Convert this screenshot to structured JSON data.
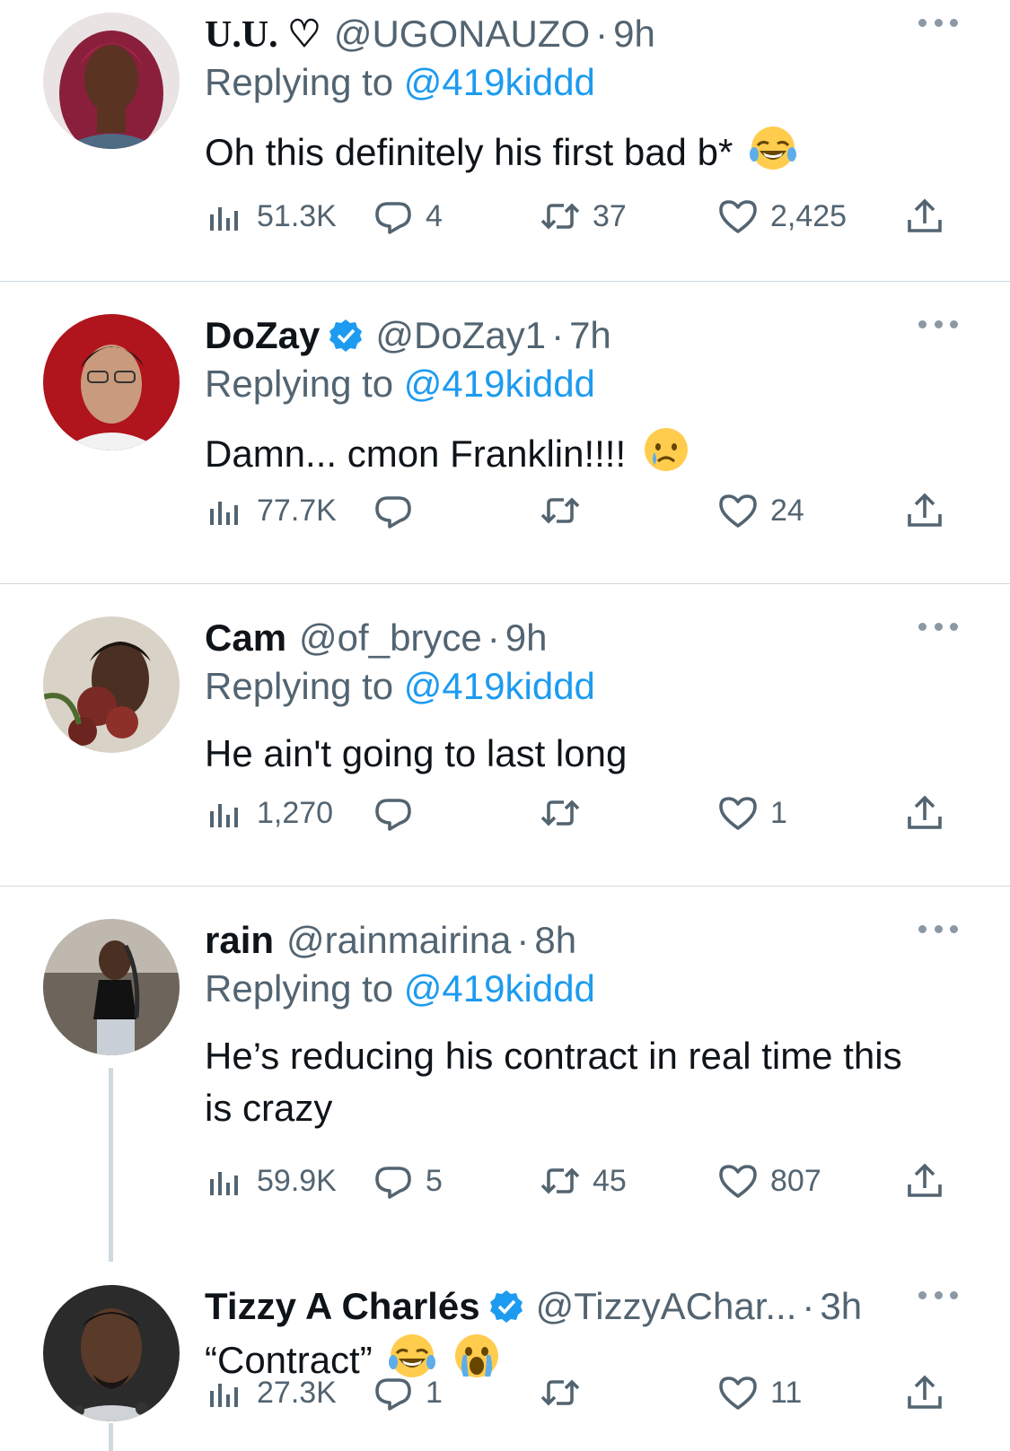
{
  "replying_label": "Replying to",
  "tweets": [
    {
      "name": "U.U. ♡",
      "handle": "@UGONAUZO",
      "time": "9h",
      "replying_to": "@419kiddd",
      "text": "Oh this definitely his first bad b*",
      "emojis": [
        "joy"
      ],
      "views": "51.3K",
      "replies": "4",
      "retweets": "37",
      "likes": "2,425",
      "verified": false
    },
    {
      "name": "DoZay",
      "handle": "@DoZay1",
      "time": "7h",
      "replying_to": "@419kiddd",
      "text": "Damn... cmon Franklin!!!!",
      "emojis": [
        "cry"
      ],
      "views": "77.7K",
      "replies": "",
      "retweets": "",
      "likes": "24",
      "verified": true
    },
    {
      "name": "Cam",
      "handle": "@of_bryce",
      "time": "9h",
      "replying_to": "@419kiddd",
      "text": "He ain't going to last long",
      "emojis": [],
      "views": "1,270",
      "replies": "",
      "retweets": "",
      "likes": "1",
      "verified": false
    },
    {
      "name": "rain",
      "handle": "@rainmairina",
      "time": "8h",
      "replying_to": "@419kiddd",
      "text_line1": "He’s reducing his contract in real time this",
      "text_line2": "is crazy",
      "emojis": [],
      "views": "59.9K",
      "replies": "5",
      "retweets": "45",
      "likes": "807",
      "verified": false
    },
    {
      "name": "Tizzy A Charlés",
      "handle": "@TizzyAChar...",
      "time": "3h",
      "text": "“Contract”",
      "emojis": [
        "joy",
        "scream"
      ],
      "views": "27.3K",
      "replies": "1",
      "retweets": "",
      "likes": "11",
      "verified": true
    }
  ],
  "colors": {
    "accent": "#1d9bf0",
    "secondary_text": "#536471",
    "divider": "#cfd9de",
    "verified": "#1d9bf0"
  },
  "icons": [
    "views-icon",
    "reply-icon",
    "retweet-icon",
    "like-icon",
    "share-icon",
    "more-icon",
    "verified-badge-icon"
  ]
}
